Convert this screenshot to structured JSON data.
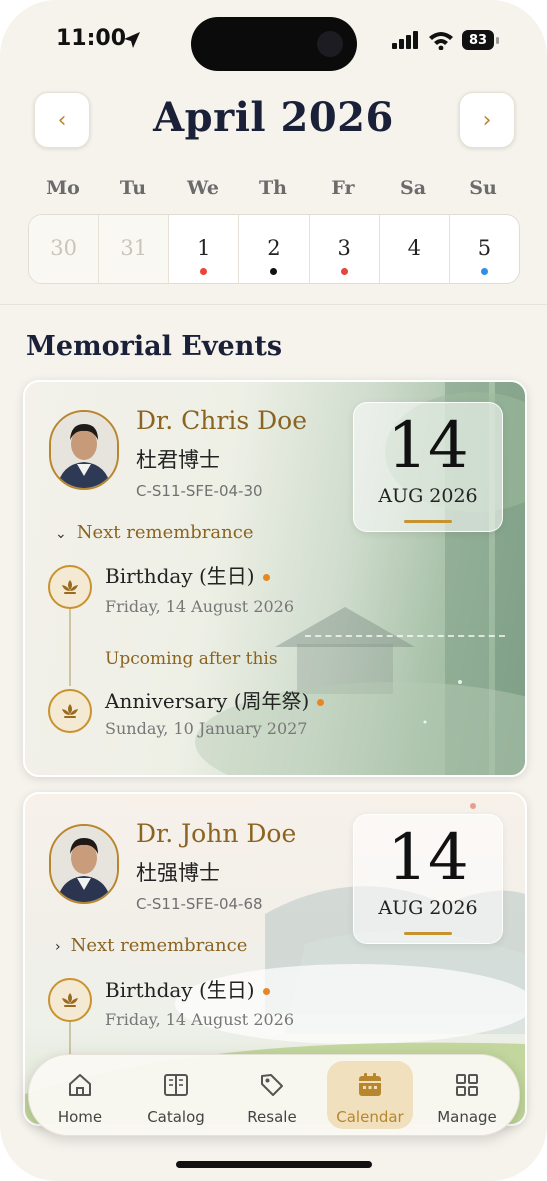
{
  "status": {
    "time": "11:00",
    "battery": "83"
  },
  "header": {
    "month_title": "April 2026",
    "prev_label": "‹",
    "next_label": "›"
  },
  "weekdays": [
    "Mo",
    "Tu",
    "We",
    "Th",
    "Fr",
    "Sa",
    "Su"
  ],
  "week": [
    {
      "num": "30",
      "muted": true,
      "dot": ""
    },
    {
      "num": "31",
      "muted": true,
      "dot": ""
    },
    {
      "num": "1",
      "muted": false,
      "dot": "#e8453c"
    },
    {
      "num": "2",
      "muted": false,
      "dot": "#111111"
    },
    {
      "num": "3",
      "muted": false,
      "dot": "#e8453c"
    },
    {
      "num": "4",
      "muted": false,
      "dot": ""
    },
    {
      "num": "5",
      "muted": false,
      "dot": "#2f8fe6"
    }
  ],
  "section_title": "Memorial Events",
  "events": [
    {
      "name": "Dr. Chris Doe",
      "chinese_name": "杜君博士",
      "code": "C-S11-SFE-04-30",
      "date_day": "14",
      "date_month": "AUG 2026",
      "next_label": "Next remembrance",
      "next_event_title": "Birthday (生日)",
      "next_event_date": "Friday, 14 August 2026",
      "upcoming_label": "Upcoming after this",
      "upcoming_event_title": "Anniversary (周年祭)",
      "upcoming_event_date": "Sunday, 10 January 2027"
    },
    {
      "name": "Dr. John Doe",
      "chinese_name": "杜强博士",
      "code": "C-S11-SFE-04-68",
      "date_day": "14",
      "date_month": "AUG 2026",
      "next_label": "Next remembrance",
      "next_event_title": "Birthday (生日)",
      "next_event_date": "Friday, 14 August 2026"
    }
  ],
  "tabs": [
    {
      "label": "Home",
      "icon": "home-icon",
      "active": false
    },
    {
      "label": "Catalog",
      "icon": "book-icon",
      "active": false
    },
    {
      "label": "Resale",
      "icon": "tag-icon",
      "active": false
    },
    {
      "label": "Calendar",
      "icon": "calendar-icon",
      "active": true
    },
    {
      "label": "Manage",
      "icon": "grid-icon",
      "active": false
    }
  ],
  "colors": {
    "accent": "#b8862d",
    "title": "#1a2038",
    "active_tab_bg": "#f0e0bd"
  }
}
